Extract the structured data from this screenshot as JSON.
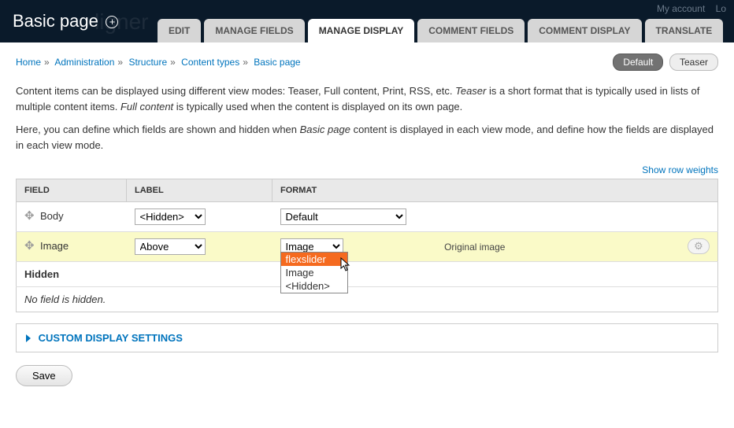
{
  "header": {
    "title": "Basic page",
    "plus": "+",
    "watermark": "ligner",
    "my_account": "My account",
    "log_out": "Lo"
  },
  "tabs": [
    {
      "label": "EDIT"
    },
    {
      "label": "MANAGE FIELDS"
    },
    {
      "label": "MANAGE DISPLAY",
      "active": true
    },
    {
      "label": "COMMENT FIELDS"
    },
    {
      "label": "COMMENT DISPLAY"
    },
    {
      "label": "TRANSLATE"
    }
  ],
  "breadcrumb": [
    "Home",
    "Administration",
    "Structure",
    "Content types",
    "Basic page"
  ],
  "modes": {
    "default": "Default",
    "teaser": "Teaser"
  },
  "desc1_a": "Content items can be displayed using different view modes: Teaser, Full content, Print, RSS, etc. ",
  "desc1_b": "Teaser",
  "desc1_c": " is a short format that is typically used in lists of multiple content items. ",
  "desc1_d": "Full content",
  "desc1_e": " is typically used when the content is displayed on its own page.",
  "desc2_a": "Here, you can define which fields are shown and hidden when ",
  "desc2_b": "Basic page",
  "desc2_c": " content is displayed in each view mode, and define how the fields are displayed in each view mode.",
  "show_weights": "Show row weights",
  "table": {
    "h_field": "FIELD",
    "h_label": "LABEL",
    "h_format": "FORMAT",
    "rows": [
      {
        "name": "Body",
        "label": "<Hidden>",
        "format": "Default",
        "summary": ""
      },
      {
        "name": "Image",
        "label": "Above",
        "format": "Image",
        "summary": "Original image"
      }
    ],
    "hidden_header": "Hidden",
    "no_hidden": "No field is hidden."
  },
  "dropdown": {
    "options": [
      "flexslider",
      "Image",
      "<Hidden>"
    ]
  },
  "custom_settings": "CUSTOM DISPLAY SETTINGS",
  "save": "Save"
}
